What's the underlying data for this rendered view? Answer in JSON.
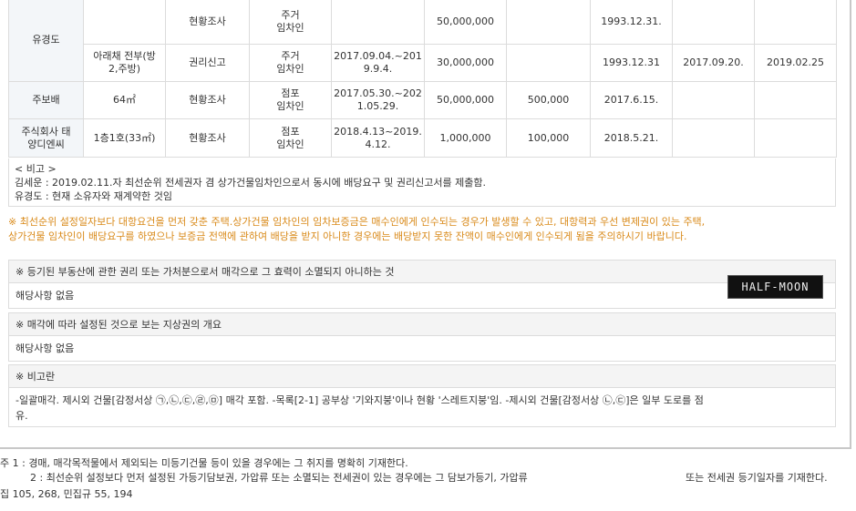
{
  "table": {
    "rows": [
      {
        "name": "",
        "location": "",
        "source": "현황조사",
        "type": "주거\n임차인",
        "period": "",
        "deposit": "50,000,000",
        "rent": "",
        "move_in": "1993.12.31.",
        "fixed_date": "",
        "claim_date": ""
      },
      {
        "name": "",
        "location": "아래채 전부(방\n2,주방)",
        "source": "권리신고",
        "type": "주거\n임차인",
        "period": "2017.09.04.~201\n9.9.4.",
        "deposit": "30,000,000",
        "rent": "",
        "move_in": "1993.12.31",
        "fixed_date": "2017.09.20.",
        "claim_date": "2019.02.25"
      },
      {
        "name": "주보배",
        "location": "64㎡",
        "source": "현황조사",
        "type": "점포\n임차인",
        "period": "2017.05.30.~202\n1.05.29.",
        "deposit": "50,000,000",
        "rent": "500,000",
        "move_in": "2017.6.15.",
        "fixed_date": "",
        "claim_date": ""
      },
      {
        "name": "주식회사 태\n양디엔씨",
        "location": "1층1호(33㎡)",
        "source": "현황조사",
        "type": "점포\n임차인",
        "period": "2018.4.13~2019.\n4.12.",
        "deposit": "1,000,000",
        "rent": "100,000",
        "move_in": "2018.5.21.",
        "fixed_date": "",
        "claim_date": ""
      }
    ],
    "merged_name": "유경도"
  },
  "notes": {
    "title": "< 비고 >",
    "line1": "김세운 : 2019.02.11.자 최선순위 전세권자 겸 상가건물임차인으로서 동시에 배당요구 및 권리신고서를 제출함.",
    "line2": "유경도 : 현재 소유자와 재계약한 것임"
  },
  "warning": "※ 최선순위 설정일자보다 대항요건을 먼저 갖춘 주택.상가건물 임차인의 임차보증금은 매수인에게 인수되는 경우가 발생할 수 있고, 대항력과 우선 변제권이 있는 주택,\n상가건물 임차인이 배당요구를 하였으나 보증금 전액에 관하여 배당을 받지 아니한 경우에는 배당받지 못한 잔액이 매수인에게 인수되게 됨을 주의하시기 바랍니다.",
  "sections": [
    {
      "title": "※ 등기된 부동산에 관한 권리 또는 가처분으로서 매각으로 그 효력이 소멸되지 아니하는 것",
      "body": "해당사항 없음"
    },
    {
      "title": "※ 매각에 따라 설정된 것으로 보는 지상권의 개요",
      "body": "해당사항 없음"
    },
    {
      "title": "※ 비고란",
      "body": "-일괄매각. 제시외 건물[감정서상 ㉠,㉡,㉢,㉣,㉤] 매각 포함. -목록[2-1] 공부상 '기와지붕'이나 현황 '스레트지붕'임. -제시외 건물[감정서상 ㉡,㉢]은 일부 도로를 점\n유."
    }
  ],
  "logo_text": "HALF-MOON",
  "footer": {
    "line1": "주 1 : 경매, 매각목적물에서 제외되는 미등기건물 등이 있을 경우에는 그 취지를 명확히 기재한다.",
    "line2a": "2 : 최선순위 설정보다 먼저 설정된 가등기담보권, 가압류 또는 소멸되는 전세권이 있는 경우에는 그 담보가등기, 가압류",
    "line2b": "또는 전세권 등기일자를 기재한다.",
    "line3": "집 105, 268, 민집규 55, 194"
  }
}
